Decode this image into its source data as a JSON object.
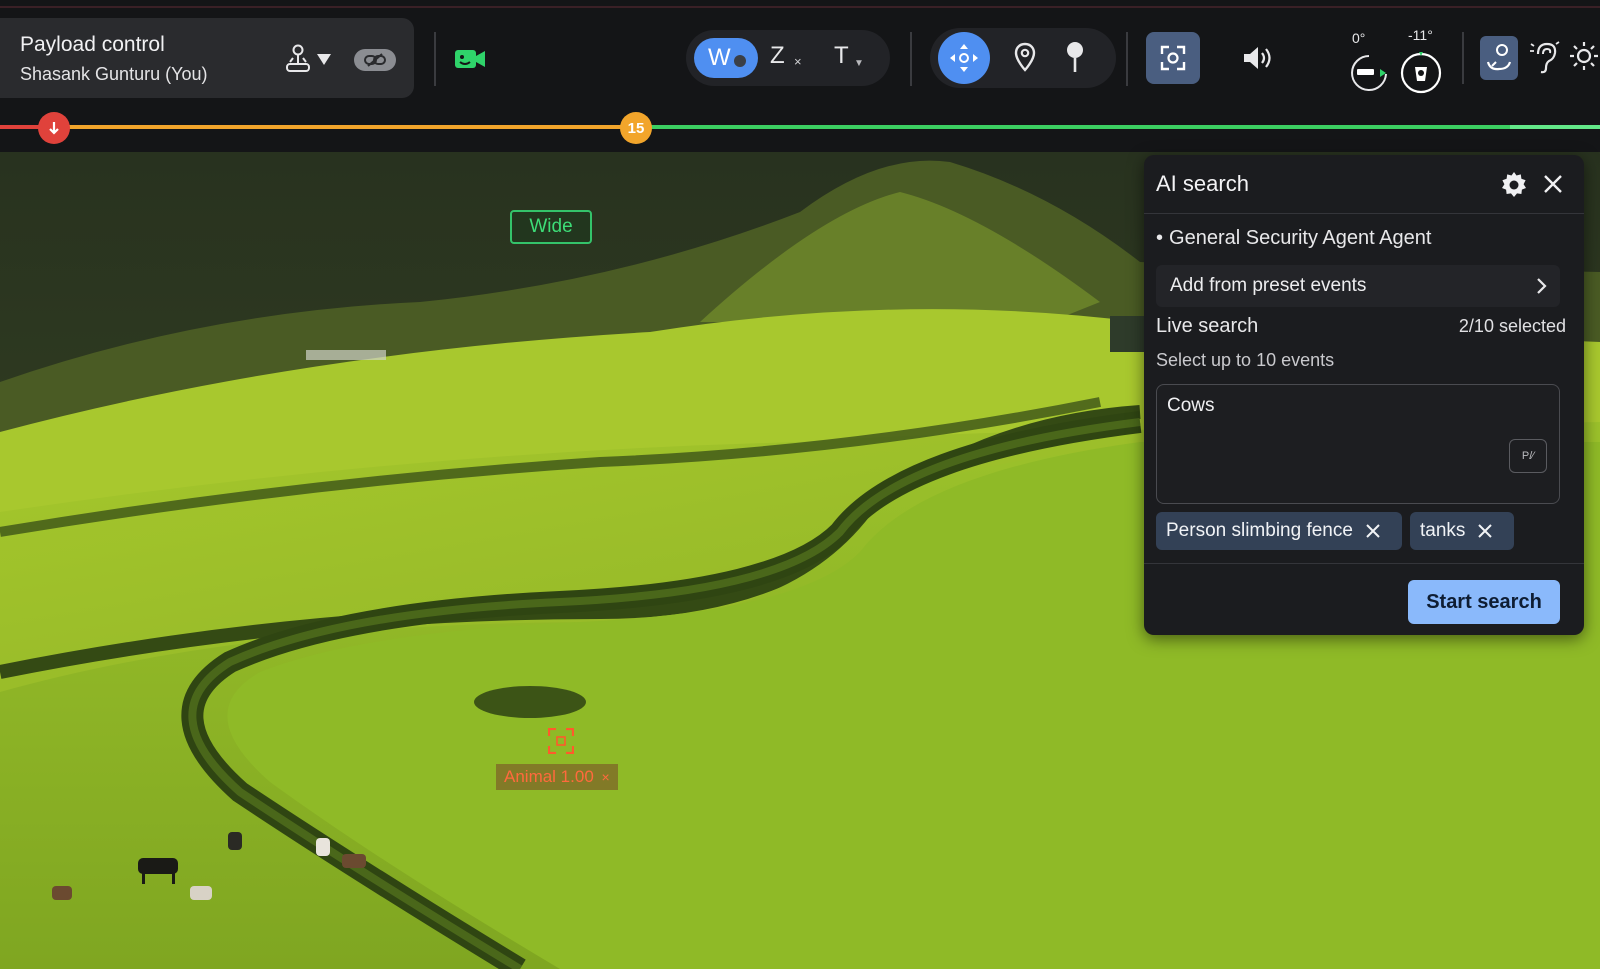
{
  "header": {
    "payload_title": "Payload control",
    "payload_user": "Shasank Gunturu (You)",
    "camera_modes": {
      "wide": "W",
      "zoom": "Z",
      "zoom_close": "×",
      "thermal": "T"
    },
    "gimbal": {
      "pitch": "0°",
      "yaw": "-11°"
    },
    "icons": [
      "joystick-icon",
      "chevron-down-icon",
      "link-icon",
      "video-camera-icon",
      "move-icon",
      "map-pin-icon",
      "pushpin-icon",
      "focus-frame-icon",
      "speaker-icon",
      "horizon-icon",
      "compass-icon",
      "detection-icon",
      "ear-icon",
      "brightness-icon"
    ],
    "colors": {
      "accent": "#4f8ff1",
      "recording": "#2fd36a"
    }
  },
  "timeline": {
    "marker_value": "15",
    "colors": {
      "start": "#e0423b",
      "progress": "#f2a52b",
      "remaining": "#3ccf62"
    }
  },
  "video": {
    "view_label": "Wide",
    "detection": {
      "label": "Animal 1.00",
      "close": "×",
      "color": "#ff6a3d"
    }
  },
  "ai_search": {
    "title": "AI search",
    "agent": "General Security Agent Agent",
    "preset_label": "Add from preset events",
    "live_label": "Live search",
    "selected_count": "2/10 selected",
    "hint": "Select up to 10 events",
    "query_value": "Cows",
    "query_button": "P/⁄",
    "chips": [
      {
        "label": "Person slimbing fence"
      },
      {
        "label": "tanks"
      }
    ],
    "start_label": "Start search",
    "colors": {
      "chip_bg": "#334156",
      "button_bg": "#8ab9fb"
    }
  }
}
